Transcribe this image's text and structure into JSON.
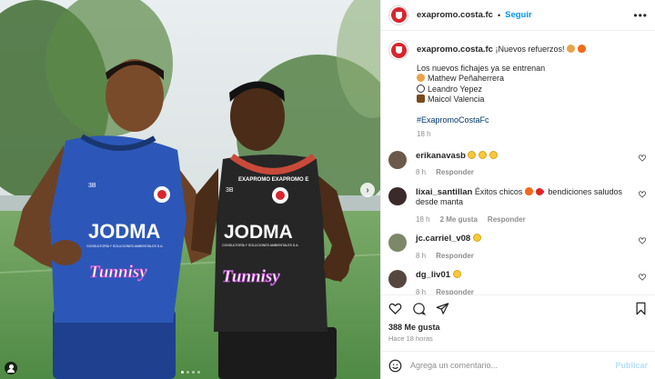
{
  "account": {
    "username": "exapromo.costa.fc",
    "follow_label": "Seguir",
    "separator": "•"
  },
  "colors": {
    "brand_red": "#d7262e",
    "link_blue": "#0095f6",
    "hashtag_blue": "#00376b",
    "muted": "#8e8e8e"
  },
  "photo": {
    "jersey_left": {
      "sponsor_main": "JODMA",
      "sponsor_sub": "CONSULTORÍA Y SOLUCIONES AMBIENTALES S.A.",
      "sponsor_brand": "Tunnisy"
    },
    "jersey_right": {
      "sponsor_main": "JODMA",
      "sponsor_sub": "CONSULTORÍA Y SOLUCIONES AMBIENTALES S.A.",
      "sponsor_brand": "Tunnisy",
      "collar_text": "EXAPROMO EXAPROMO E"
    },
    "carousel_dots": 4,
    "active_dot": 0
  },
  "caption": {
    "username": "exapromo.costa.fc",
    "headline": "¡Nuevos refuerzos!",
    "headline_icons": [
      "bicep-icon",
      "fire-icon"
    ],
    "intro": "Los nuevos fichajes ya se entrenan",
    "players": [
      {
        "icon": "ball-icon",
        "name": "Mathew Peñaherrera"
      },
      {
        "icon": "soccer-ball-icon",
        "name": "Leandro Yepez"
      },
      {
        "icon": "bicep-icon",
        "name": "Maicol Valencia"
      }
    ],
    "hashtag": "#ExapromoCostaFc",
    "time": "18 h"
  },
  "comments": [
    {
      "username": "erikanavasb",
      "text": "",
      "icons": [
        "laugh-icon",
        "laugh-icon",
        "laugh-icon"
      ],
      "time": "8 h",
      "likes": "",
      "reply": "Responder",
      "avatar_color": "#6b5a4a"
    },
    {
      "username": "lixai_santillan",
      "text": "Éxitos chicos",
      "text2": "bendiciones saludos desde manta",
      "icons": [
        "fire-icon",
        "heart-icon"
      ],
      "time": "18 h",
      "likes": "2 Me gusta",
      "reply": "Responder",
      "avatar_color": "#3b2a2a"
    },
    {
      "username": "jc.carriel_v08",
      "text": "",
      "icons": [
        "laugh-icon"
      ],
      "time": "8 h",
      "likes": "",
      "reply": "Responder",
      "avatar_color": "#7d8868"
    },
    {
      "username": "dg_liv01",
      "text": "",
      "icons": [
        "laugh-icon"
      ],
      "time": "8 h",
      "likes": "",
      "reply": "Responder",
      "avatar_color": "#54473f"
    }
  ],
  "post": {
    "likes": "388 Me gusta",
    "ago": "Hace 18 horas",
    "comment_placeholder": "Agrega un comentario...",
    "publish_label": "Publicar"
  }
}
